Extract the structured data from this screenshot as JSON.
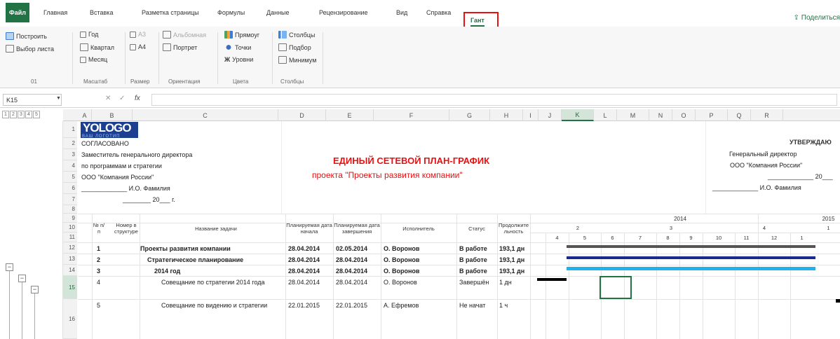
{
  "tabs": {
    "file": "Файл",
    "home": "Главная",
    "insert": "Вставка",
    "layout": "Разметка страницы",
    "formulas": "Формулы",
    "data": "Данные",
    "review": "Рецензирование",
    "view": "Вид",
    "help": "Справка",
    "gant": "Гант",
    "share": "Поделиться"
  },
  "ribbon": {
    "build": "Построить",
    "select_list": "Выбор листа",
    "group_01": "01",
    "year": "Год",
    "quarter": "Квартал",
    "month": "Месяц",
    "group_scale": "Масштаб",
    "a3": "A3",
    "a4": "A4",
    "group_size": "Размер",
    "landscape": "Альбомная",
    "portrait": "Портрет",
    "group_orientation": "Ориентация",
    "rectangle": "Прямоуг",
    "dots": "Точки",
    "levels": "Уровни",
    "group_colors": "Цвета",
    "columns": "Столбцы",
    "fit": "Подбор",
    "minimum": "Минимум",
    "group_columns": "Столбцы"
  },
  "formula_bar": {
    "cell_ref": "K15",
    "fx": "fx",
    "cancel": "✕",
    "enter": "✓"
  },
  "outline_levels": [
    "1",
    "2",
    "3",
    "4",
    "5"
  ],
  "columns": [
    "A",
    "B",
    "C",
    "D",
    "E",
    "F",
    "G",
    "H",
    "I",
    "J",
    "K",
    "L",
    "M",
    "N",
    "O",
    "P",
    "Q",
    "R"
  ],
  "selected_column": "K",
  "rows": [
    "1",
    "2",
    "3",
    "4",
    "5",
    "6",
    "7",
    "8",
    "9",
    "10",
    "11",
    "12",
    "13",
    "14",
    "15",
    "16"
  ],
  "selected_row": "15",
  "header_left": {
    "logo": "YOLOGO",
    "logo_sub": "ВАШ ЛОГОТИП",
    "agreed": "СОГЛАСОВАНО",
    "deputy": "Заместитель генерального директора",
    "programs": "по программам и стратегии",
    "company": "ООО \"Компания России\"",
    "signature": "_____________ И.О. Фамилия",
    "date": "________ 20___ г."
  },
  "header_right": {
    "approve": "УТВЕРЖДАЮ",
    "gen_dir": "Генеральный директор",
    "company": "ООО \"Компания России\"",
    "date": "_____________ 20___",
    "signature": "_____________ И.О. Фамилия"
  },
  "title": {
    "main": "ЕДИНЫЙ СЕТЕВОЙ ПЛАН-ГРАФИК",
    "sub": "проекта \"Проекты развития компании\""
  },
  "table_headers": {
    "num": "№ п/п",
    "structure": "Номер в структуре",
    "task": "Название задачи",
    "plan_start": "Планируемая дата начала",
    "plan_end": "Планируемая дата завершения",
    "executor": "Исполнитель",
    "status": "Статус",
    "duration": "Продолжительность"
  },
  "gantt_header": {
    "year1": "2014",
    "year2": "2015",
    "quarters": [
      "2",
      "3",
      "4",
      "1"
    ],
    "months": [
      "4",
      "5",
      "6",
      "7",
      "8",
      "9",
      "10",
      "11",
      "12",
      "1"
    ]
  },
  "tasks": [
    {
      "num": "1",
      "task": "Проекты развития компании",
      "start": "28.04.2014",
      "end": "02.05.2014",
      "executor": "О. Воронов",
      "status": "В работе",
      "duration": "193,1 дн",
      "bold": true
    },
    {
      "num": "2",
      "task": "Стратегическое планирование",
      "start": "28.04.2014",
      "end": "28.04.2014",
      "executor": "О. Воронов",
      "status": "В работе",
      "duration": "193,1 дн",
      "bold": true
    },
    {
      "num": "3",
      "task": "2014 год",
      "start": "28.04.2014",
      "end": "28.04.2014",
      "executor": "О. Воронов",
      "status": "В работе",
      "duration": "193,1 дн",
      "bold": true
    },
    {
      "num": "4",
      "task": "Совещание по стратегии 2014 года",
      "start": "28.04.2014",
      "end": "28.04.2014",
      "executor": "О. Воронов",
      "status": "Завершён",
      "duration": "1 дн",
      "bold": false
    },
    {
      "num": "5",
      "task": "Совещание по видению и стратегии",
      "start": "22.01.2015",
      "end": "22.01.2015",
      "executor": "А. Ефремов",
      "status": "Не начат",
      "duration": "1 ч",
      "bold": false
    }
  ],
  "colors": {
    "excel_green": "#217346",
    "title_red": "#e81010",
    "bar_level1": "#555555",
    "bar_level2": "#1a2a8c",
    "bar_level3": "#1fb2ec",
    "bar_task": "#000000"
  }
}
